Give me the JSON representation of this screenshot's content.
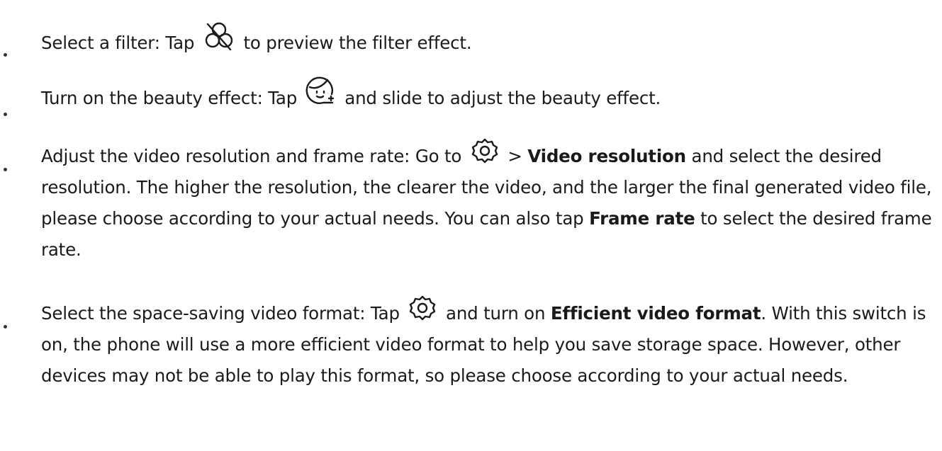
{
  "items": [
    {
      "before": "Select a filter: Tap",
      "icon": "filter-off-icon",
      "after": "to preview the filter effect."
    },
    {
      "before": "Turn on the beauty effect: Tap",
      "icon": "beauty-face-icon",
      "after": "and slide to adjust the beauty effect."
    },
    {
      "before": "Adjust the video resolution and frame rate: Go to",
      "icon": "settings-gear-icon",
      "mid": ">",
      "bold1": "Video resolution",
      "text1": "and select the desired resolution. The higher the resolution, the clearer the video, and the larger the final generated video file, please choose according to your actual needs. You can also tap",
      "bold2": "Frame rate",
      "text2": "to select the desired frame rate."
    },
    {
      "before": "Select the space-saving video format: Tap",
      "icon": "settings-gear-icon",
      "mid": "and turn on",
      "bold1": "Efficient video format",
      "text1": ". With this switch is on, the phone will use a more efficient video format to help you save storage space. However, other devices may not be able to play this format, so please choose according to your actual needs."
    }
  ]
}
